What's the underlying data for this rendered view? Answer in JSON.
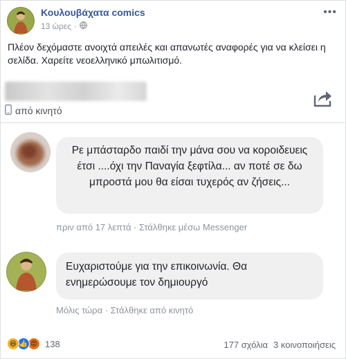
{
  "post": {
    "page_name": "Κουλουβάχατα comics",
    "time": "13 ώρες",
    "audience_icon": "globe-icon",
    "text": "Πλέον δεχόμαστε ανοιχτά απειλές και απανωτές αναφορές για να κλείσει η σελίδα. Χαρείτε νεοελληνικό μπωλιτισμό."
  },
  "shared": {
    "from_label": "από κινητό",
    "share_icon": "share-icon"
  },
  "messages": [
    {
      "text": "Ρε μπάσταρδο παιδί  την μάνα σου να κοροιδευεις έτσι ....όχι την Παναγία ξεφτίλα... αν ποτέ σε δω μπροστά μου θα είσαι τυχερός αν ζήσεις...",
      "meta": "πριν από 17 λεπτά · Στάλθηκε μέσω Messenger"
    },
    {
      "text": "Ευχαριστούμε για την επικοινωνία. Θα ενημερώσουμε τον δημιουργό",
      "meta": "Μόλις τώρα · Στάλθηκε από κινητό"
    }
  ],
  "footer": {
    "reactions_count": "138",
    "comments": "177 σχόλια",
    "shares": "3 κοινοποιήσεις"
  },
  "colors": {
    "link": "#385898",
    "bubble": "#f1f0f0",
    "muted": "#90949c"
  }
}
